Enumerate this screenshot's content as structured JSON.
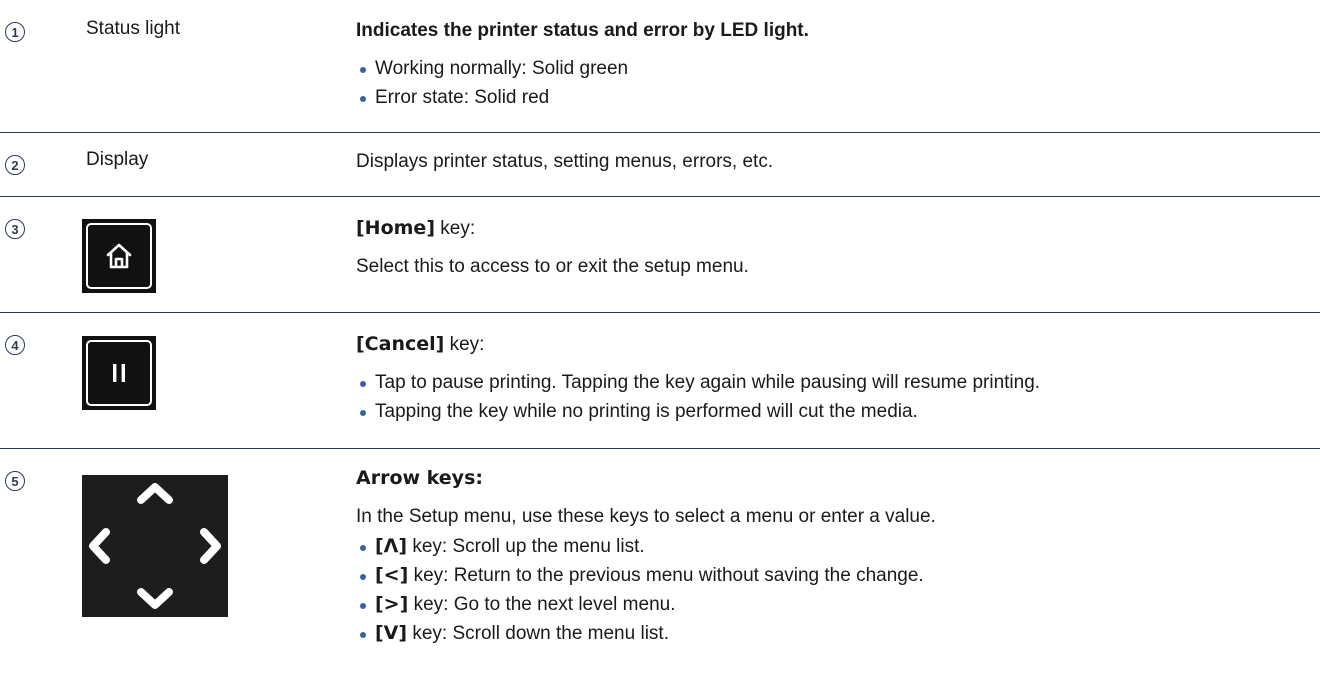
{
  "rows": [
    {
      "number": "1",
      "name": "Status light",
      "title": "Indicates the printer status and error by LED light.",
      "bullets": [
        "Working normally: Solid green",
        "Error state: Solid red"
      ]
    },
    {
      "number": "2",
      "name": "Display",
      "text": "Displays printer status, setting menus, errors, etc."
    },
    {
      "number": "3",
      "icon": "home-key-icon",
      "key": "[Home]",
      "key_suffix": " key:",
      "text": "Select this to access to or exit the setup menu."
    },
    {
      "number": "4",
      "icon": "pause-key-icon",
      "key": "[Cancel]",
      "key_suffix": " key:",
      "bullets": [
        "Tap to pause printing. Tapping the key again while pausing will resume printing.",
        "Tapping the key while no printing is performed will cut the media."
      ]
    },
    {
      "number": "5",
      "icon": "arrow-keys-icon",
      "title": "Arrow keys:",
      "text": "In the Setup menu, use these keys to select a menu or enter a value.",
      "bullets": [
        {
          "key": "[Λ]",
          "text": " key: Scroll up the menu list."
        },
        {
          "key": "[<]",
          "text": " key: Return to the previous menu without saving the change."
        },
        {
          "key": "[>]",
          "text": " key: Go to the next level menu."
        },
        {
          "key": "[V]",
          "text": " key: Scroll down the menu list."
        }
      ]
    }
  ],
  "colors": {
    "accent": "#2e3a5c",
    "bullet": "#3b5fa6",
    "icon_bg": "#111111"
  }
}
